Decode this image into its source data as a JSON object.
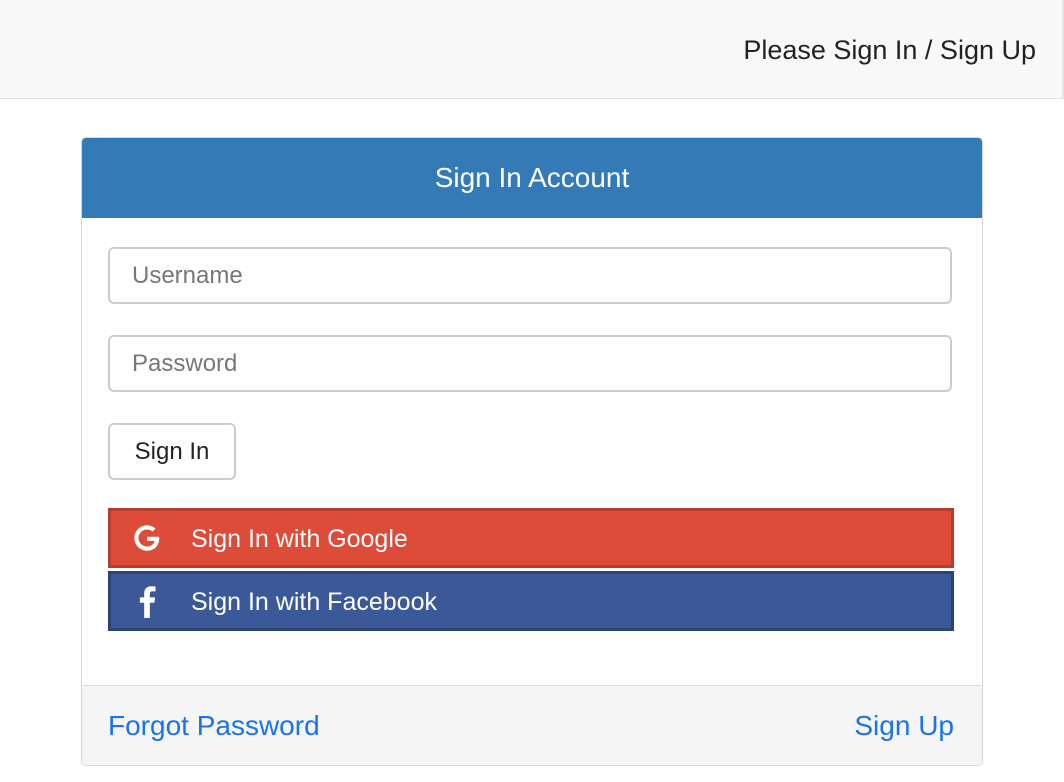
{
  "header": {
    "title": "Please Sign In / Sign Up"
  },
  "panel": {
    "heading": "Sign In Account",
    "username_placeholder": "Username",
    "password_placeholder": "Password",
    "signin_label": "Sign In",
    "google_label": "Sign In with Google",
    "facebook_label": "Sign In with Facebook",
    "footer": {
      "forgot_label": "Forgot Password",
      "signup_label": "Sign Up"
    }
  },
  "icons": {
    "google": "google-icon",
    "facebook": "facebook-icon"
  },
  "colors": {
    "heading_bg": "#337ab7",
    "google_bg": "#dd4b39",
    "facebook_bg": "#3b5998",
    "link": "#1a73e8"
  }
}
